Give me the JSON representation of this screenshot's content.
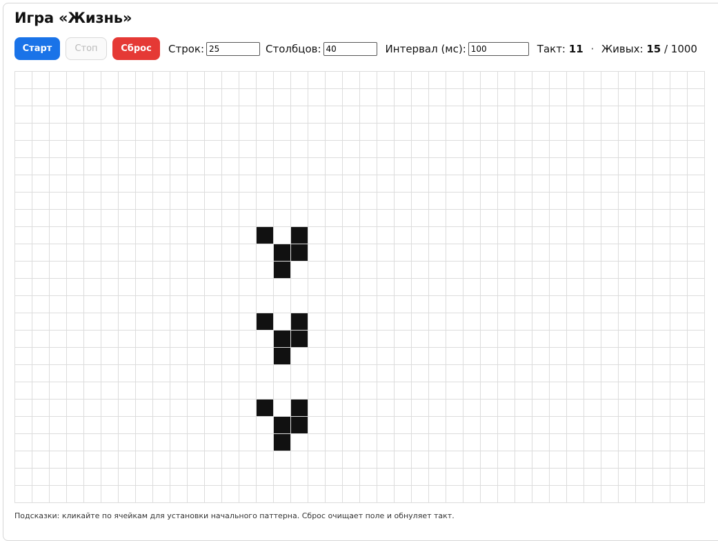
{
  "app": {
    "title": "Игра «Жизнь»"
  },
  "toolbar": {
    "start_label": "Старт",
    "stop_label": "Стоп",
    "reset_label": "Сброс",
    "rows_label": "Строк:",
    "rows_value": "25",
    "cols_label": "Столбцов:",
    "cols_value": "40",
    "interval_label": "Интервал (мс):",
    "interval_value": "100"
  },
  "stats": {
    "tick_label": "Такт:",
    "tick_value": "11",
    "separator": "·",
    "alive_label": "Живых:",
    "alive_value": "15",
    "max_text": "/ 1000"
  },
  "grid": {
    "rows": 25,
    "cols": 40,
    "alive_cells": [
      [
        9,
        14
      ],
      [
        9,
        16
      ],
      [
        10,
        15
      ],
      [
        10,
        16
      ],
      [
        11,
        15
      ],
      [
        14,
        14
      ],
      [
        14,
        16
      ],
      [
        15,
        15
      ],
      [
        15,
        16
      ],
      [
        16,
        15
      ],
      [
        19,
        14
      ],
      [
        19,
        16
      ],
      [
        20,
        15
      ],
      [
        20,
        16
      ],
      [
        21,
        15
      ]
    ]
  },
  "colors": {
    "start": "#1a73e8",
    "reset": "#e53935",
    "alive": "#111111",
    "grid_line": "#dcdcdc"
  },
  "hint": "Подсказки: кликайте по ячейкам для установки начального паттерна. Сброс очищает поле и обнуляет такт."
}
